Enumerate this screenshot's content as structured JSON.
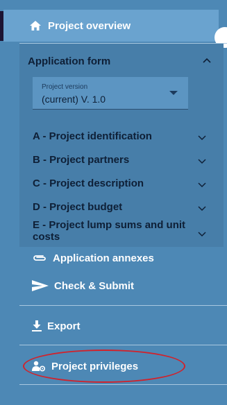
{
  "sidebar": {
    "project_overview": {
      "label": "Project overview",
      "icon": "home-icon"
    },
    "application_form": {
      "label": "Application form",
      "icon": "chevron-up-icon",
      "version": {
        "label": "Project version",
        "value": "(current) V. 1.0"
      },
      "sections": [
        {
          "label": "A - Project identification",
          "icon": "chevron-down-icon"
        },
        {
          "label": "B - Project partners",
          "icon": "chevron-down-icon"
        },
        {
          "label": "C - Project description",
          "icon": "chevron-down-icon"
        },
        {
          "label": "D - Project budget",
          "icon": "chevron-down-icon"
        },
        {
          "label": "E - Project lump sums and unit costs",
          "icon": "chevron-down-icon"
        }
      ]
    },
    "application_annexes": {
      "label": "Application annexes",
      "icon": "attachment-icon"
    },
    "check_submit": {
      "label": "Check & Submit",
      "icon": "send-icon"
    },
    "export": {
      "label": "Export",
      "icon": "download-icon"
    },
    "project_privileges": {
      "label": "Project privileges",
      "icon": "users-settings-icon"
    }
  },
  "colors": {
    "sidebar_bg": "#4d88b5",
    "active_item_bg": "#6aa3cf",
    "highlight": "#d1222b"
  }
}
